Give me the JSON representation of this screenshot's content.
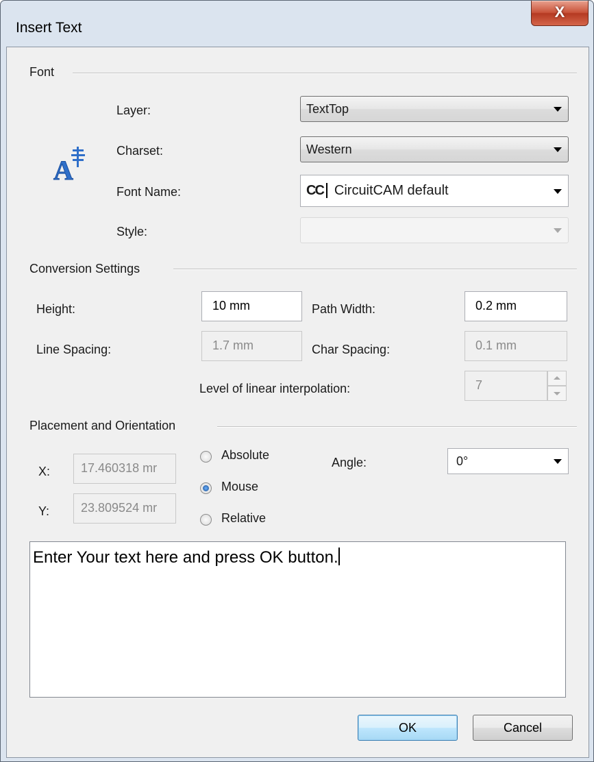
{
  "window": {
    "title": "Insert Text",
    "close_label": "X"
  },
  "font_group": {
    "label": "Font",
    "layer_label": "Layer:",
    "layer_value": "TextTop",
    "charset_label": "Charset:",
    "charset_value": "Western",
    "font_name_label": "Font Name:",
    "font_name_icon_text": "CC",
    "font_name_value": "CircuitCAM default",
    "style_label": "Style:",
    "style_value": ""
  },
  "conversion_group": {
    "label": "Conversion Settings",
    "height_label": "Height:",
    "height_value": "10 mm",
    "path_width_label": "Path Width:",
    "path_width_value": "0.2 mm",
    "line_spacing_label": "Line Spacing:",
    "line_spacing_value": "1.7 mm",
    "char_spacing_label": "Char Spacing:",
    "char_spacing_value": "0.1 mm",
    "interp_label": "Level of linear interpolation:",
    "interp_value": "7"
  },
  "placement_group": {
    "label": "Placement and Orientation",
    "x_label": "X:",
    "x_value": "17.460318 mr",
    "y_label": "Y:",
    "y_value": "23.809524 mr",
    "radio_absolute": "Absolute",
    "radio_mouse": "Mouse",
    "radio_relative": "Relative",
    "selected_mode": "Mouse",
    "angle_label": "Angle:",
    "angle_value": "0°"
  },
  "text_area": {
    "value": "Enter Your text here and press OK button."
  },
  "buttons": {
    "ok": "OK",
    "cancel": "Cancel"
  },
  "icons": {
    "font_icon": "font-charset-icon",
    "close": "close-icon"
  },
  "colors": {
    "close_button": "#c9533a",
    "title_bar": "#dbe4ef",
    "icon_blue": "#2f6fc9"
  }
}
